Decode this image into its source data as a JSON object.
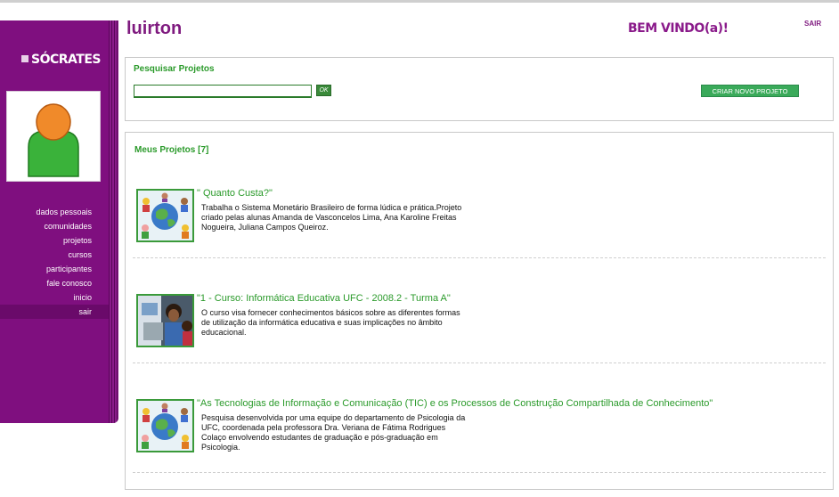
{
  "header": {
    "user_name": "luirton",
    "welcome": "BEM VINDO(a)!",
    "logout": "SAIR"
  },
  "sidebar": {
    "logo": "SÓCRATES",
    "avatar_icon": "user-avatar-icon",
    "nav": [
      {
        "label": "dados pessoais"
      },
      {
        "label": "comunidades"
      },
      {
        "label": "projetos"
      },
      {
        "label": "cursos"
      },
      {
        "label": "participantes"
      },
      {
        "label": "fale conosco"
      },
      {
        "label": "inicio"
      },
      {
        "label": "sair"
      }
    ]
  },
  "search": {
    "title": "Pesquisar Projetos",
    "value": "",
    "ok_label": "OK",
    "create_label": "CRIAR NOVO PROJETO"
  },
  "projects": {
    "title": "Meus Projetos [7]",
    "items": [
      {
        "title": "\" Quanto Custa?\"",
        "description": "Trabalha o Sistema Monetário Brasileiro de forma lúdica e prática.Projeto criado pelas alunas Amanda de Vasconcelos Lima, Ana Karoline Freitas Nogueira, Juliana Campos Queiroz.",
        "thumbnail": "globe-people-icon"
      },
      {
        "title": "\"1 - Curso: Informática Educativa UFC - 2008.2 - Turma A\"",
        "description": "O curso visa fornecer conhecimentos básicos sobre as diferentes formas de utilização da informática educativa e suas implicações no âmbito educacional.",
        "thumbnail": "students-computer-photo"
      },
      {
        "title": "\"As Tecnologias de Informação e Comunicação (TIC) e os Processos de Construção Compartilhada de Conhecimento\"",
        "description": "Pesquisa desenvolvida por uma equipe do departamento de Psicologia da UFC, coordenada pela professora Dra. Veriana de Fátima Rodrigues Colaço envolvendo estudantes de graduação e pós-graduação em Psicologia.",
        "thumbnail": "globe-people-icon"
      }
    ]
  },
  "colors": {
    "sidebar": "#7f0f7f",
    "accent_green": "#2a9a2a",
    "title_purple": "#7f1a7f"
  }
}
